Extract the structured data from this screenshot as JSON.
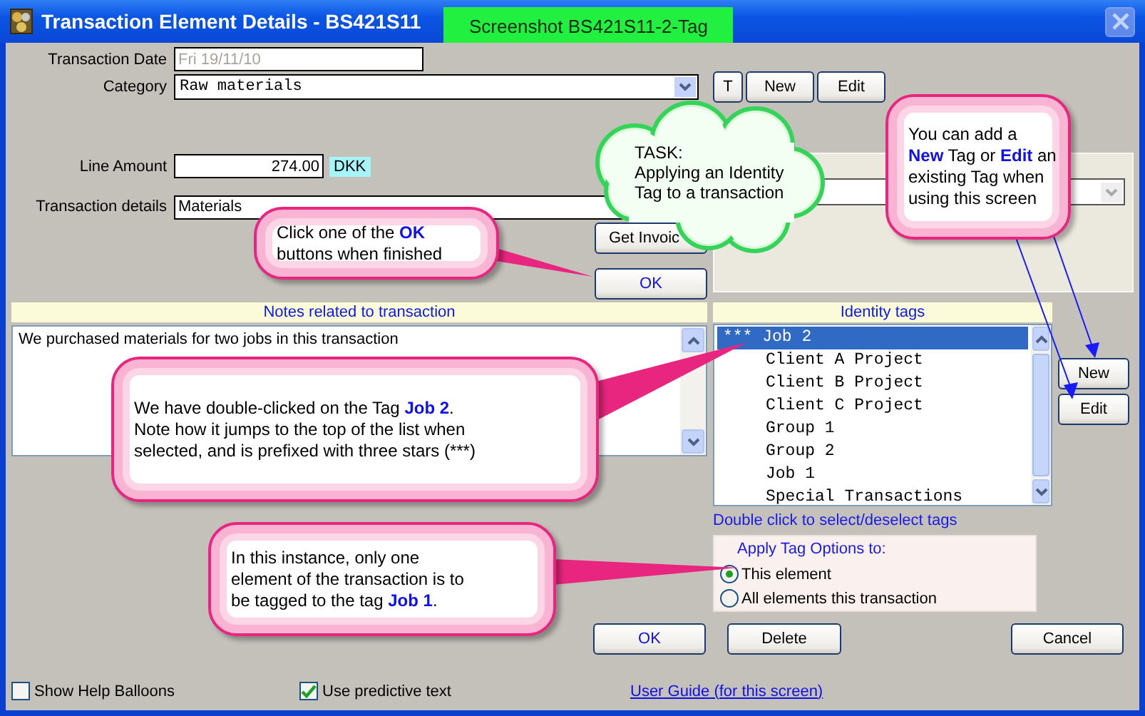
{
  "window": {
    "title": "Transaction Element Details - BS421S11",
    "banner": "Screenshot BS421S11-2-Tag"
  },
  "form": {
    "date_label": "Transaction Date",
    "date_value": "Fri 19/11/10",
    "date_disabled": true,
    "category_label": "Category",
    "category_value": "Raw materials",
    "amount_label": "Line Amount",
    "amount_value": "274.00",
    "currency": "DKK",
    "details_label": "Transaction details",
    "details_value": "Materials"
  },
  "category_buttons": [
    "T",
    "New",
    "Edit"
  ],
  "get_invoice_button": "Get Invoic",
  "top_ok_button": "OK",
  "notes": {
    "header": "Notes related to transaction",
    "text": "We purchased materials for two jobs in this transaction"
  },
  "identity_tags": {
    "header": "Identity tags",
    "items": [
      {
        "label": "*** Job 2",
        "selected": true
      },
      {
        "label": "Client A Project",
        "selected": false
      },
      {
        "label": "Client B Project",
        "selected": false
      },
      {
        "label": "Client C Project",
        "selected": false
      },
      {
        "label": "Group 1",
        "selected": false
      },
      {
        "label": "Group 2",
        "selected": false
      },
      {
        "label": "Job 1",
        "selected": false
      },
      {
        "label": "Special Transactions",
        "selected": false
      }
    ],
    "hint": "Double click to select/deselect tags",
    "buttons": [
      "New",
      "Edit"
    ]
  },
  "apply_options": {
    "title": "Apply Tag Options to:",
    "options": [
      {
        "label": "This element",
        "selected": true
      },
      {
        "label": "All elements this transaction",
        "selected": false
      }
    ]
  },
  "buttons": [
    "OK",
    "Delete",
    "Cancel"
  ],
  "footer": {
    "checkboxes": [
      {
        "label": "Show Help Balloons",
        "checked": false
      },
      {
        "label": "Use predictive text",
        "checked": true
      }
    ],
    "link": "User Guide (for this screen)"
  },
  "callouts": [
    {
      "kind": "cloud",
      "lines": [
        "TASK:",
        "Applying an Identity",
        "Tag to a transaction"
      ]
    },
    {
      "kind": "balloon",
      "parts": [
        {
          "text": "Click one of the ",
          "emphasis": false
        },
        {
          "text": "OK",
          "emphasis": true
        },
        {
          "text": "\nbuttons when finished",
          "emphasis": false
        }
      ]
    },
    {
      "kind": "balloon",
      "parts": [
        {
          "text": "You can add a\n",
          "emphasis": false
        },
        {
          "text": "New",
          "emphasis": true
        },
        {
          "text": " Tag or ",
          "emphasis": false
        },
        {
          "text": "Edit",
          "emphasis": true
        },
        {
          "text": " an\nexisting Tag when\nusing this screen",
          "emphasis": false
        }
      ]
    },
    {
      "kind": "balloon",
      "parts": [
        {
          "text": "We have double-clicked on the Tag ",
          "emphasis": false
        },
        {
          "text": "Job 2",
          "emphasis": true
        },
        {
          "text": ".\nNote how it jumps to the top of the list when\nselected, and is prefixed with three stars (***)",
          "emphasis": false
        }
      ]
    },
    {
      "kind": "balloon",
      "parts": [
        {
          "text": "In this instance, only one\nelement of the transaction is to\nbe tagged to the tag ",
          "emphasis": false
        },
        {
          "text": "Job 1",
          "emphasis": true
        },
        {
          "text": ".",
          "emphasis": false
        }
      ]
    }
  ]
}
